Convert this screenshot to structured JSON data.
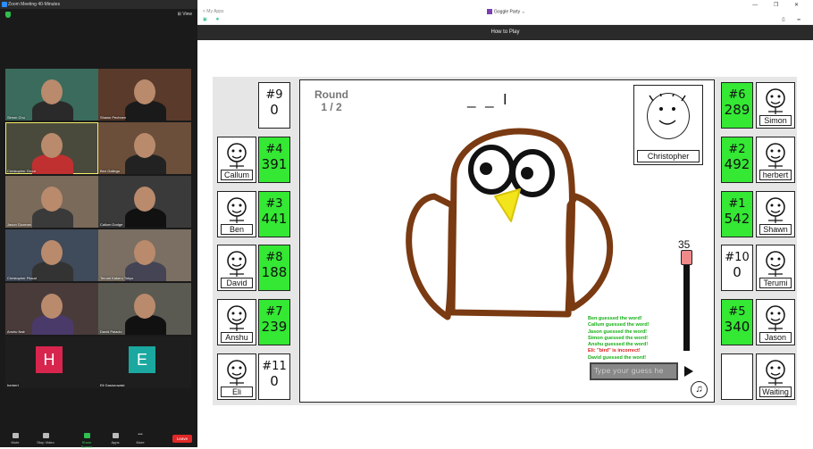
{
  "zoom": {
    "title": "Zoom Meeting 40-Minutes",
    "view_label": "View",
    "participants": [
      {
        "name": "Simon Chu",
        "bg": "#3a6b5c"
      },
      {
        "name": "Shawn Pechnen",
        "bg": "#5a3a2a"
      },
      {
        "name": "Christopher Groot",
        "bg": "#4a4a3c"
      },
      {
        "name": "Ben Gallego",
        "bg": "#6b4f3a"
      },
      {
        "name": "Jason Guzman",
        "bg": "#7a6a5a"
      },
      {
        "name": "Callum Dodge",
        "bg": "#3a3a3a"
      },
      {
        "name": "Christopher Pilaud",
        "bg": "#3f4a5a"
      },
      {
        "name": "Terumi Kakeru Tokyo",
        "bg": "#7a6f62"
      },
      {
        "name": "Anshu Nair",
        "bg": "#4a3b3b"
      },
      {
        "name": "David Palacio",
        "bg": "#5a5a52"
      },
      {
        "name": "herbert",
        "bg": "#2a2a2a"
      },
      {
        "name": "Eli Gasiorowski",
        "bg": "#2a2a2a"
      }
    ],
    "avatars": [
      {
        "letter": "H",
        "color": "#d8254d"
      },
      {
        "letter": "E",
        "color": "#1aa8a0"
      }
    ],
    "toolbar": [
      "Mute",
      "Stop Video",
      "Share Screen",
      "Apps",
      "More"
    ],
    "leave_label": "Leave"
  },
  "browser": {
    "back_label": "< My Apps",
    "tab_title": "Goggle Party",
    "controls": "— ❐ ✕",
    "left_icons": "▣ ❖",
    "right_icons": "⎙ ☰"
  },
  "game": {
    "how_to_play": "How to Play",
    "round_label": "Round",
    "round_value": "1 / 2",
    "hint": "_ _ l",
    "drawer_name": "Christopher",
    "timer": "35",
    "guess_placeholder": "Type your guess he",
    "music_icon": "♫",
    "chat": [
      {
        "text": "Ben guessed the word!",
        "color": "#15b015"
      },
      {
        "text": "Callum guessed the word!",
        "color": "#15b015"
      },
      {
        "text": "Jason guessed the word!",
        "color": "#15b015"
      },
      {
        "text": "Simon guessed the word!",
        "color": "#15b015"
      },
      {
        "text": "Anshu guessed the word!",
        "color": "#15b015"
      },
      {
        "text": "Eli: \"bird\" is incorrect!",
        "color": "#e01818"
      },
      {
        "text": "David guessed the word!",
        "color": "#15b015"
      }
    ],
    "left_players": [
      {
        "name": "Callum",
        "rank": "#4",
        "score": "391",
        "green": true
      },
      {
        "name": "Ben",
        "rank": "#3",
        "score": "441",
        "green": true
      },
      {
        "name": "David",
        "rank": "#8",
        "score": "188",
        "green": true
      },
      {
        "name": "Anshu",
        "rank": "#7",
        "score": "239",
        "green": true
      },
      {
        "name": "Eli",
        "rank": "#11",
        "score": "0",
        "green": false
      }
    ],
    "top_left_score": {
      "rank": "#9",
      "score": "0"
    },
    "right_players": [
      {
        "name": "Simon",
        "rank": "#6",
        "score": "289",
        "green": true
      },
      {
        "name": "herbert",
        "rank": "#2",
        "score": "492",
        "green": true
      },
      {
        "name": "Shawn",
        "rank": "#1",
        "score": "542",
        "green": true
      },
      {
        "name": "Terumi",
        "rank": "#10",
        "score": "0",
        "green": false
      },
      {
        "name": "Jason",
        "rank": "#5",
        "score": "340",
        "green": true
      },
      {
        "name": "Waiting",
        "rank": "",
        "score": "",
        "green": false
      }
    ]
  }
}
